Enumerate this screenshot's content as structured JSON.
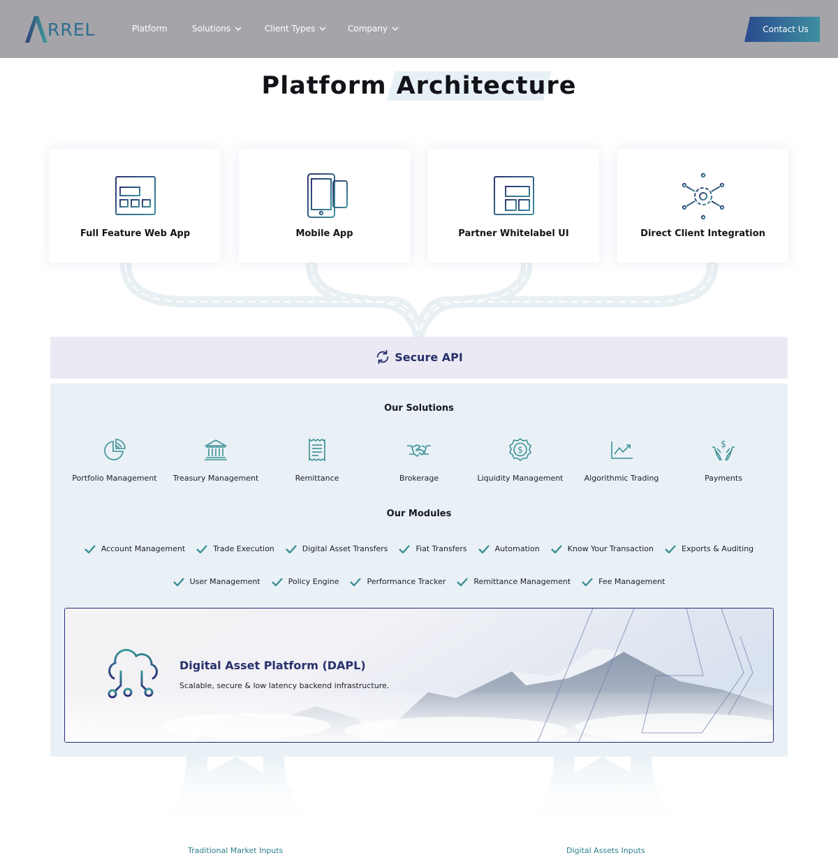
{
  "header": {
    "logo_text": "ARREL",
    "nav": [
      {
        "label": "Platform",
        "has_dropdown": false
      },
      {
        "label": "Solutions",
        "has_dropdown": true
      },
      {
        "label": "Client Types",
        "has_dropdown": true
      },
      {
        "label": "Company",
        "has_dropdown": true
      }
    ],
    "cta_label": "Contact Us"
  },
  "title": {
    "part1": "Platform",
    "part2": "Architecture"
  },
  "channels": [
    {
      "label": "Full Feature Web App",
      "icon": "web-app-icon"
    },
    {
      "label": "Mobile App",
      "icon": "mobile-app-icon"
    },
    {
      "label": "Partner Whitelabel UI",
      "icon": "whitelabel-ui-icon"
    },
    {
      "label": "Direct Client Integration",
      "icon": "integration-gear-icon"
    }
  ],
  "api": {
    "label": "Secure API",
    "icon": "sync-icon"
  },
  "solutions": {
    "heading": "Our Solutions",
    "items": [
      {
        "label": "Portfolio Management",
        "icon": "pie-chart-icon"
      },
      {
        "label": "Treasury Management",
        "icon": "bank-icon"
      },
      {
        "label": "Remittance",
        "icon": "receipt-icon"
      },
      {
        "label": "Brokerage",
        "icon": "handshake-icon"
      },
      {
        "label": "Liquidity Management",
        "icon": "dollar-badge-icon"
      },
      {
        "label": "Algorithmic Trading",
        "icon": "trend-chart-icon"
      },
      {
        "label": "Payments",
        "icon": "hands-dollar-icon"
      }
    ]
  },
  "modules": {
    "heading": "Our Modules",
    "row1": [
      "Account Management",
      "Trade Execution",
      "Digital Asset Transfers",
      "Fiat Transfers",
      "Automation",
      "Know Your Transaction",
      "Exports & Auditing"
    ],
    "row2": [
      "User Management",
      "Policy Engine",
      "Performance Tracker",
      "Remittance Management",
      "Fee Management"
    ]
  },
  "dapl": {
    "title": "Digital Asset Platform (DAPL)",
    "subtitle": "Scalable, secure & low latency backend infrastructure."
  },
  "inputs": {
    "left": "Traditional Market Inputs",
    "right": "Digital Assets Inputs"
  },
  "colors": {
    "nav_bg": "#a5a4a9",
    "brand_navy": "#27306b",
    "brand_teal": "#2f8f8c",
    "panel_bg": "#e9f1f6",
    "api_bg": "#ebeaf4"
  }
}
